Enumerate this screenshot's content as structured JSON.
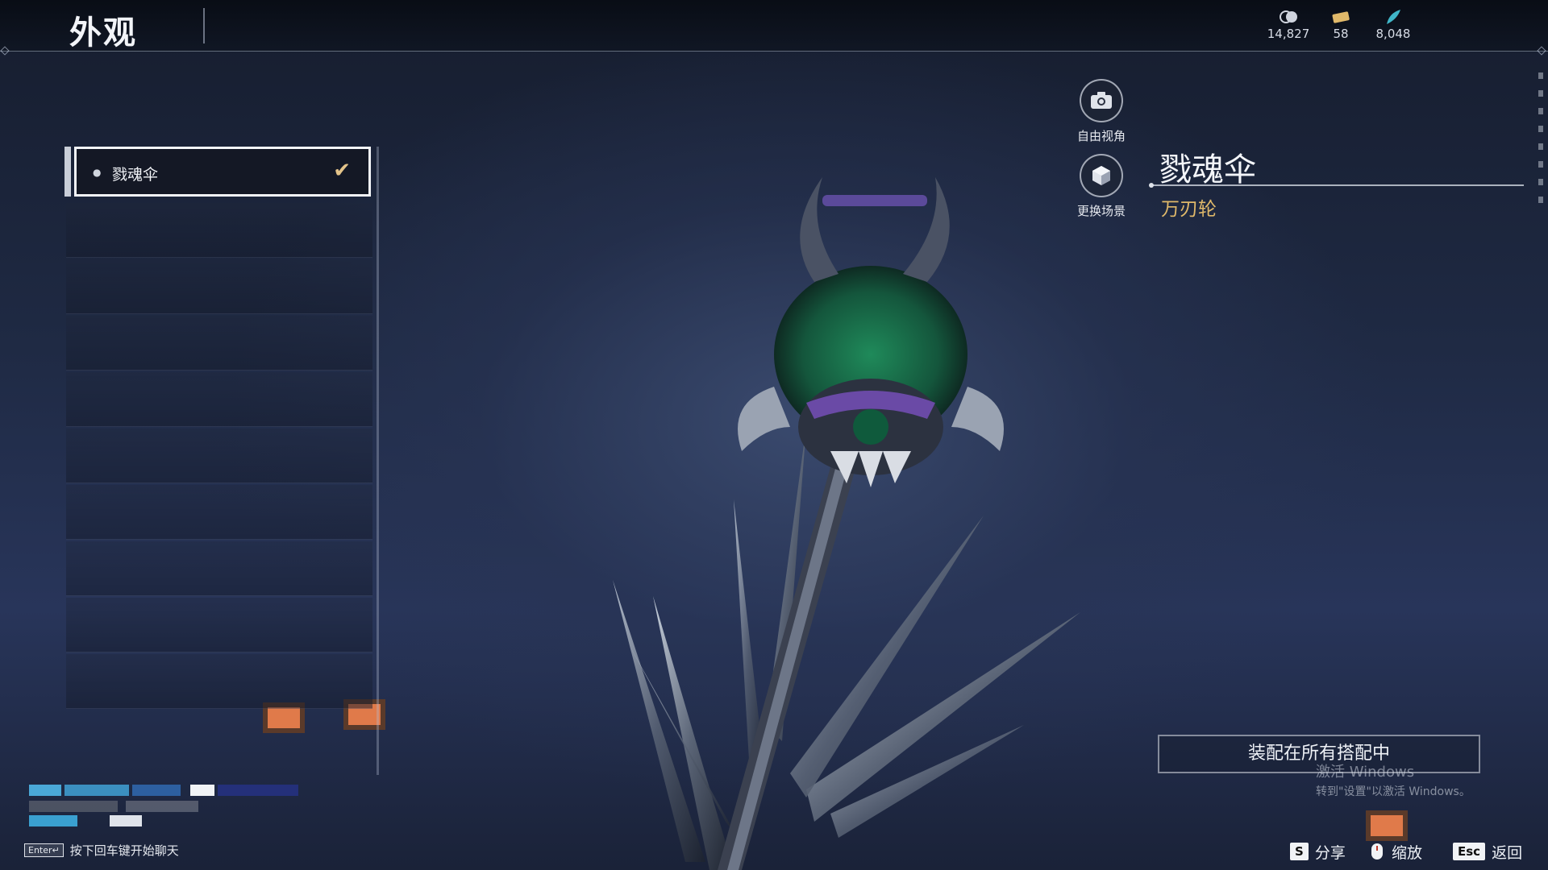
{
  "header": {
    "title": "外观",
    "currencies": [
      {
        "icon": "coin-icon",
        "value": "14,827"
      },
      {
        "icon": "ticket-icon",
        "value": "58"
      },
      {
        "icon": "feather-icon",
        "value": "8,048"
      }
    ]
  },
  "list": {
    "selected_item": "戮魂伞"
  },
  "actions": {
    "free_view": "自由视角",
    "change_scene": "更换场景"
  },
  "item": {
    "name": "戮魂伞",
    "type": "万刃轮"
  },
  "equip": {
    "label": "装配在所有搭配中"
  },
  "watermark": {
    "line1": "激活 Windows",
    "line2": "转到\"设置\"以激活 Windows。"
  },
  "footer": {
    "chat_key": "Enter↵",
    "chat_hint": "按下回车键开始聊天",
    "share_key": "S",
    "share": "分享",
    "zoom": "缩放",
    "back_key": "Esc",
    "back": "返回"
  },
  "colors": {
    "accent_gold": "#e0b96a",
    "check": "#e4c48a"
  }
}
